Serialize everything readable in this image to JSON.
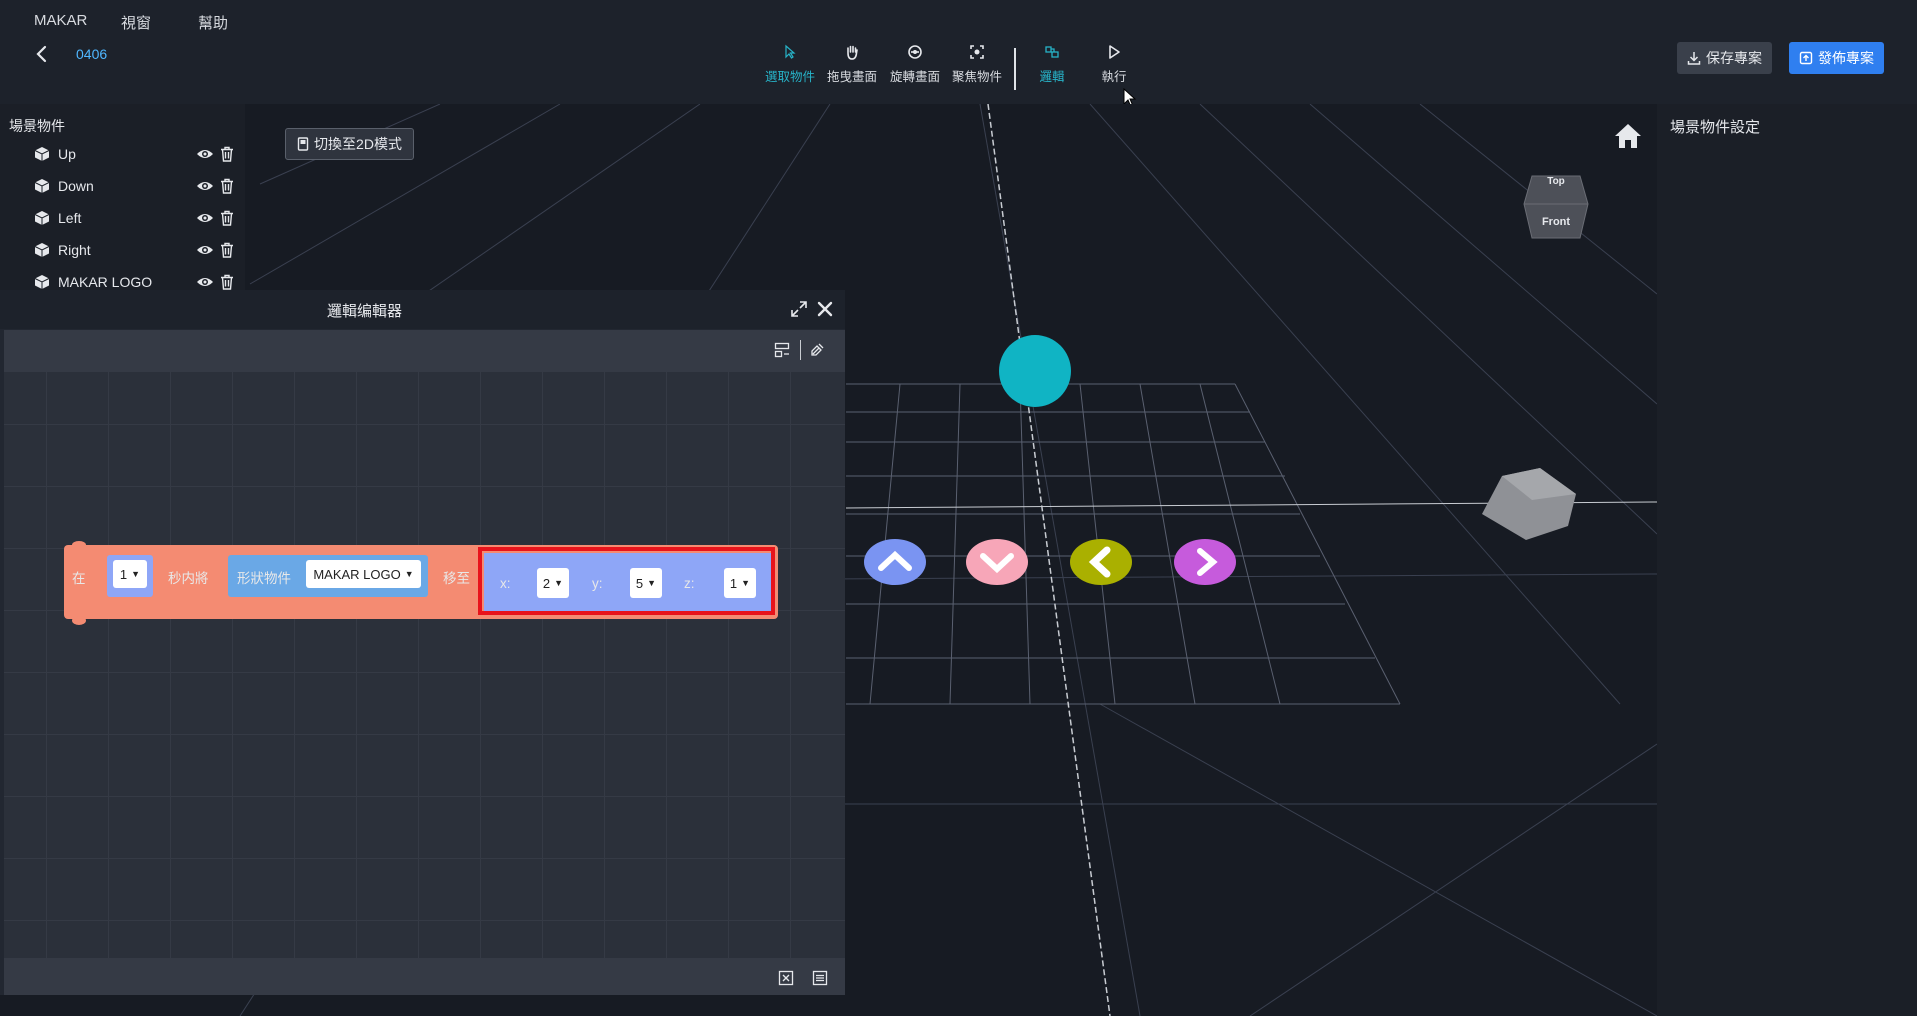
{
  "menu": {
    "items": [
      "MAKAR",
      "視窗",
      "幫助"
    ]
  },
  "project": {
    "name": "0406"
  },
  "toolbar": {
    "tools": [
      {
        "label": "選取物件",
        "icon": "cursor-icon",
        "active": true
      },
      {
        "label": "拖曳畫面",
        "icon": "hand-icon",
        "active": false
      },
      {
        "label": "旋轉畫面",
        "icon": "rotate-icon",
        "active": false
      },
      {
        "label": "聚焦物件",
        "icon": "focus-icon",
        "active": false
      },
      {
        "label": "邏輯",
        "icon": "logic-icon",
        "active": true
      },
      {
        "label": "執行",
        "icon": "play-icon",
        "active": false
      }
    ],
    "save_label": "保存專案",
    "publish_label": "發佈專案"
  },
  "viewport": {
    "switch_label": "切換至2D模式",
    "view_cube": {
      "top": "Top",
      "front": "Front"
    }
  },
  "scene_panel": {
    "title": "場景物件",
    "items": [
      {
        "label": "Up"
      },
      {
        "label": "Down"
      },
      {
        "label": "Left"
      },
      {
        "label": "Right"
      },
      {
        "label": "MAKAR LOGO"
      }
    ]
  },
  "right_panel": {
    "title": "場景物件設定"
  },
  "logic_editor": {
    "title": "邏輯编輯器",
    "block": {
      "prefix": "在",
      "time_value": "1",
      "seconds_text": "秒内將",
      "shape_label": "形狀物件",
      "object_value": "MAKAR LOGO",
      "move_text": "移至",
      "x_label": "x:",
      "x_value": "2",
      "y_label": "y:",
      "y_value": "5",
      "z_label": "z:",
      "z_value": "1"
    }
  },
  "colors": {
    "accent": "#27b3c8",
    "publish": "#2f7ff0",
    "block": "#f48b72",
    "block_blue": "#8ea6f7",
    "highlight": "#e8131b"
  }
}
